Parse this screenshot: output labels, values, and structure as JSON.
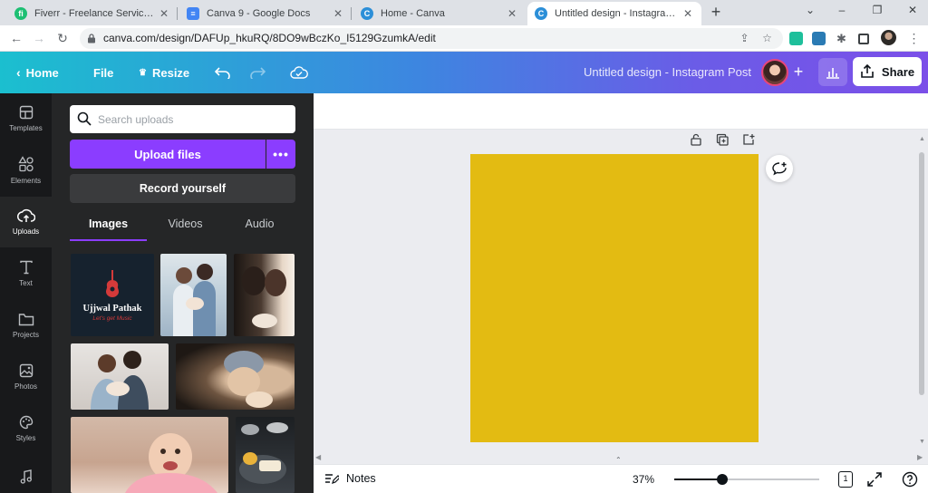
{
  "browser": {
    "tabs": [
      {
        "title": "Fiverr - Freelance Services Marke",
        "favicon_color": "#1dbf73",
        "favicon_letter": "fi"
      },
      {
        "title": "Canva 9 - Google Docs",
        "favicon_color": "#4285f4",
        "favicon_letter": "≡"
      },
      {
        "title": "Home - Canva",
        "favicon_color": "#00c4cc",
        "favicon_letter": "C"
      },
      {
        "title": "Untitled design - Instagram Post",
        "favicon_color": "#00c4cc",
        "favicon_letter": "C"
      }
    ],
    "active_tab": 3,
    "url": "canva.com/design/DAFUp_hkuRQ/8DO9wBczKo_I5129GzumkA/edit"
  },
  "header": {
    "home_label": "Home",
    "file_label": "File",
    "resize_label": "Resize",
    "doc_title": "Untitled design - Instagram Post",
    "share_label": "Share",
    "gradient_start": "#1bbfcf",
    "gradient_end": "#7b4fe8"
  },
  "rail": {
    "items": [
      {
        "label": "Templates",
        "icon": "templates-icon"
      },
      {
        "label": "Elements",
        "icon": "elements-icon"
      },
      {
        "label": "Uploads",
        "icon": "uploads-icon"
      },
      {
        "label": "Text",
        "icon": "text-icon"
      },
      {
        "label": "Projects",
        "icon": "projects-icon"
      },
      {
        "label": "Photos",
        "icon": "photos-icon"
      },
      {
        "label": "Styles",
        "icon": "styles-icon"
      },
      {
        "label": "",
        "icon": "music-icon"
      }
    ],
    "active_index": 2
  },
  "uploads": {
    "search_placeholder": "Search uploads",
    "upload_button": "Upload files",
    "more_button": "•••",
    "record_button": "Record yourself",
    "tabs": [
      "Images",
      "Videos",
      "Audio"
    ],
    "active_tab": 0,
    "logo_name": "Ujjwal Pathak",
    "logo_tagline": "Let's get Music"
  },
  "canvas": {
    "page_color": "#e3bb12",
    "accent": "#8b3dff"
  },
  "footer": {
    "notes_label": "Notes",
    "zoom": "37%",
    "zoom_fraction": 0.33,
    "page_count": "1"
  }
}
